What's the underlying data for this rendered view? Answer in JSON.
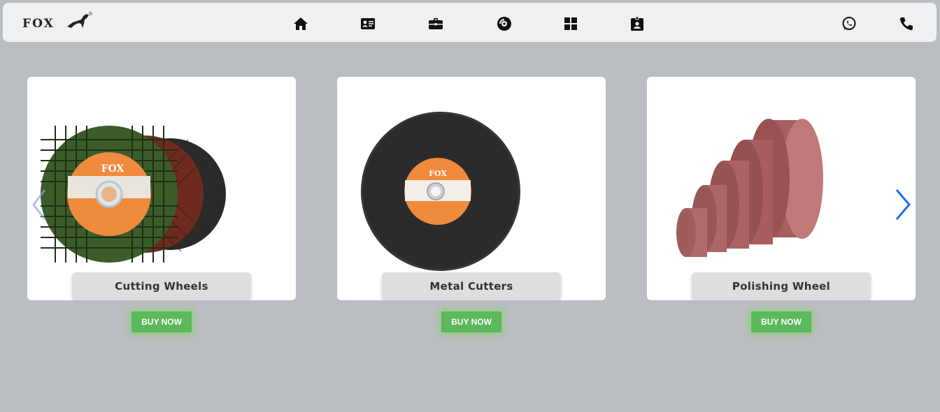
{
  "brand": {
    "logo_text": "FOX",
    "logo_mark": "horse-icon",
    "trademark": "®"
  },
  "nav": {
    "icons": [
      "home-icon",
      "contact-card-icon",
      "briefcase-icon",
      "disc-icon",
      "grid-icon",
      "id-badge-icon"
    ],
    "right_icons": [
      "whatsapp-icon",
      "phone-icon"
    ]
  },
  "products": [
    {
      "label": "Cutting Wheels",
      "button": "BUY NOW"
    },
    {
      "label": "Metal Cutters",
      "button": "BUY NOW"
    },
    {
      "label": "Polishing Wheel",
      "button": "BUY NOW"
    }
  ],
  "disc_label": {
    "brand": "FOX"
  },
  "carousel": {
    "prev_icon": "chevron-left-icon",
    "next_icon": "chevron-right-icon"
  },
  "colors": {
    "page_bg": "#babdc1",
    "nav_bg": "#eff0f2",
    "button": "#5cb85c",
    "arrow": "#1a73e8",
    "disc_orange": "#f08a3c",
    "polish_red": "#b76a6a"
  }
}
